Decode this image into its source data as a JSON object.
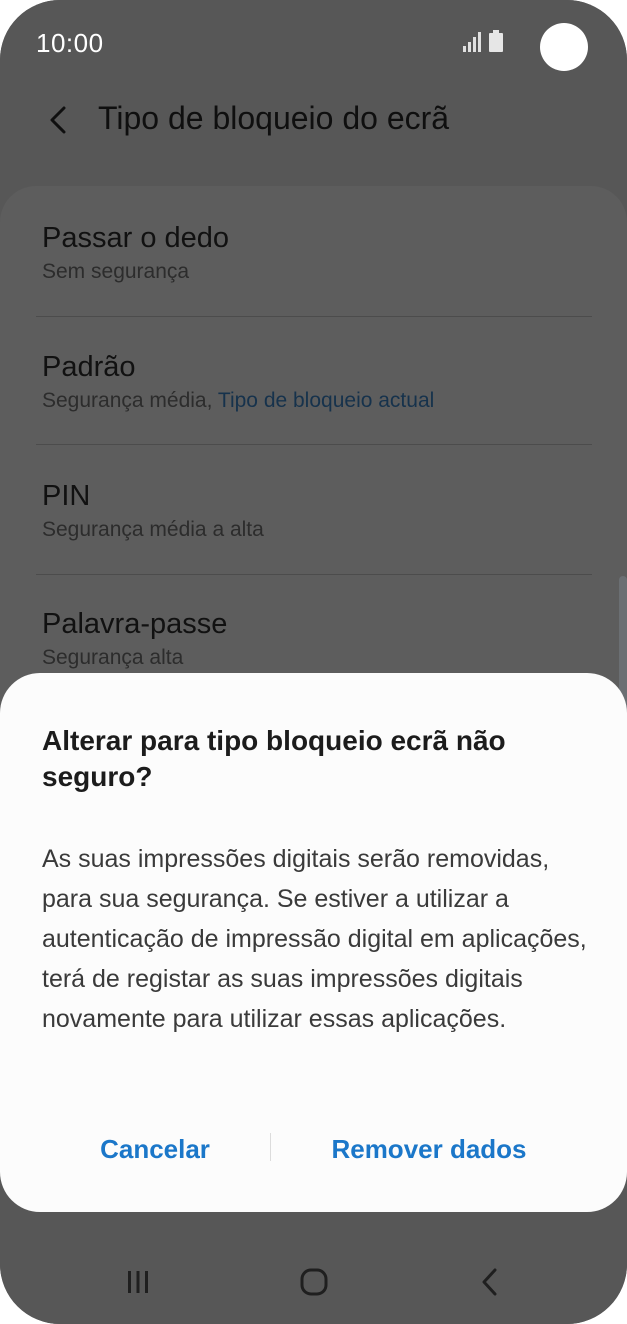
{
  "status_bar": {
    "time": "10:00",
    "icons": [
      "signal-icon",
      "battery-icon"
    ]
  },
  "header": {
    "back_icon": "chevron-left-icon",
    "title": "Tipo de bloqueio do ecrã"
  },
  "lock_types": [
    {
      "title": "Passar o dedo",
      "subtitle": "Sem segurança",
      "subtitle_accent": ""
    },
    {
      "title": "Padrão",
      "subtitle": "Segurança média, ",
      "subtitle_accent": "Tipo de bloqueio actual"
    },
    {
      "title": "PIN",
      "subtitle": "Segurança média a alta",
      "subtitle_accent": ""
    },
    {
      "title": "Palavra-passe",
      "subtitle": "Segurança alta",
      "subtitle_accent": ""
    }
  ],
  "dialog": {
    "title": "Alterar para tipo bloqueio ecrã não seguro?",
    "body": "As suas impressões digitais serão removidas, para sua segurança. Se estiver a utilizar a autenticação de impressão digital em aplicações, terá de registar as suas impressões digitais novamente para utilizar essas aplicações.",
    "cancel_label": "Cancelar",
    "confirm_label": "Remover dados"
  },
  "nav_bar": {
    "recents_icon": "recents-icon",
    "home_icon": "home-icon",
    "back_icon": "back-icon"
  },
  "colors": {
    "accent": "#1b77c9",
    "dim_background": "#575757",
    "dialog_background": "#fcfcfc"
  }
}
